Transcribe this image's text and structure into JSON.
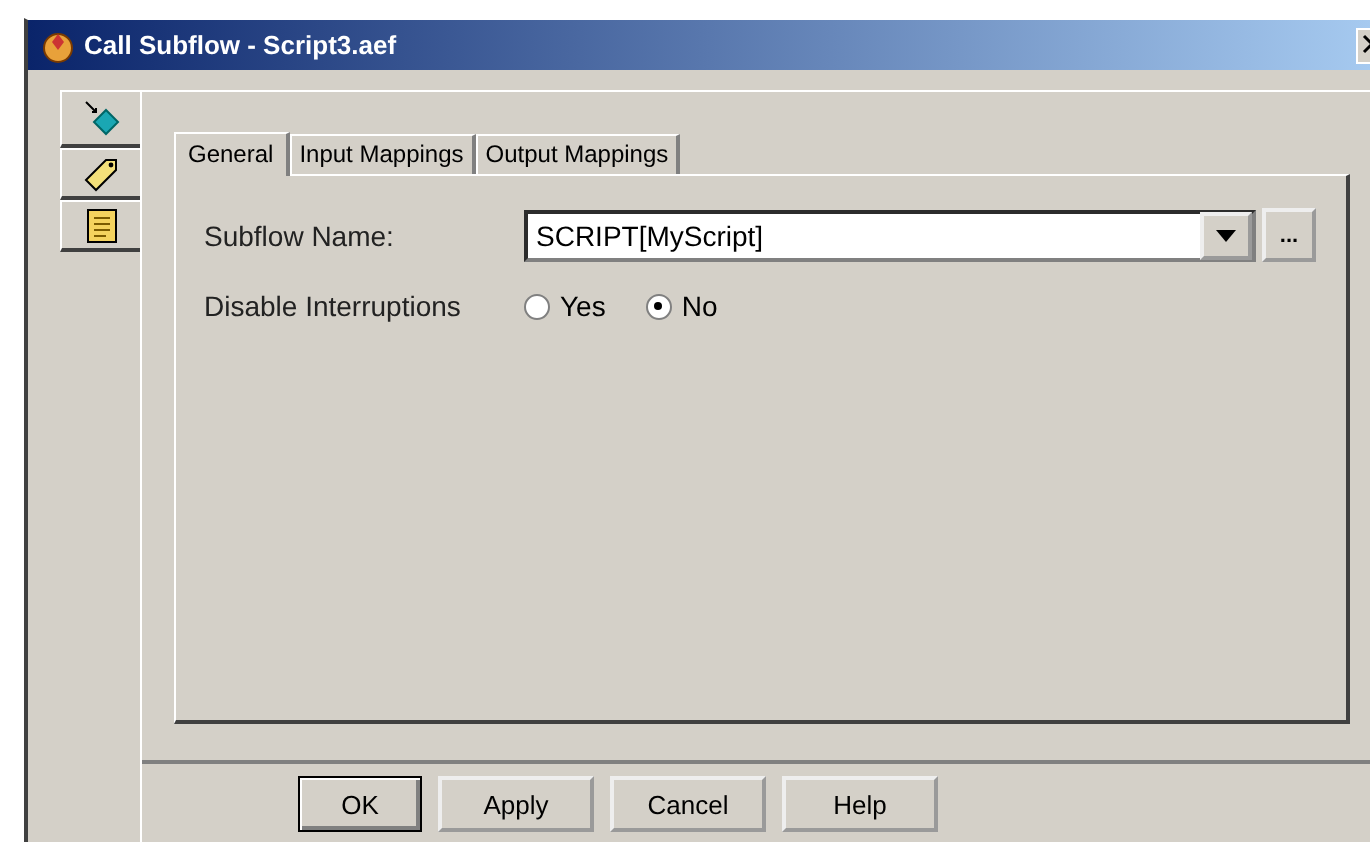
{
  "window": {
    "title": "Call Subflow - Script3.aef"
  },
  "side_tabs": [
    {
      "kind": "diamond",
      "selected": true
    },
    {
      "kind": "tag",
      "selected": false
    },
    {
      "kind": "note",
      "selected": false
    }
  ],
  "tabs": [
    {
      "label": "General",
      "selected": true
    },
    {
      "label": "Input Mappings",
      "selected": false
    },
    {
      "label": "Output Mappings",
      "selected": false
    }
  ],
  "subflow_name": {
    "label": "Subflow Name:",
    "value": "SCRIPT[MyScript]",
    "browse": "..."
  },
  "disable_interruptions": {
    "label": "Disable Interruptions",
    "options": [
      {
        "label": "Yes",
        "selected": false
      },
      {
        "label": "No",
        "selected": true
      }
    ]
  },
  "buttons": [
    "OK",
    "Apply",
    "Cancel",
    "Help"
  ]
}
